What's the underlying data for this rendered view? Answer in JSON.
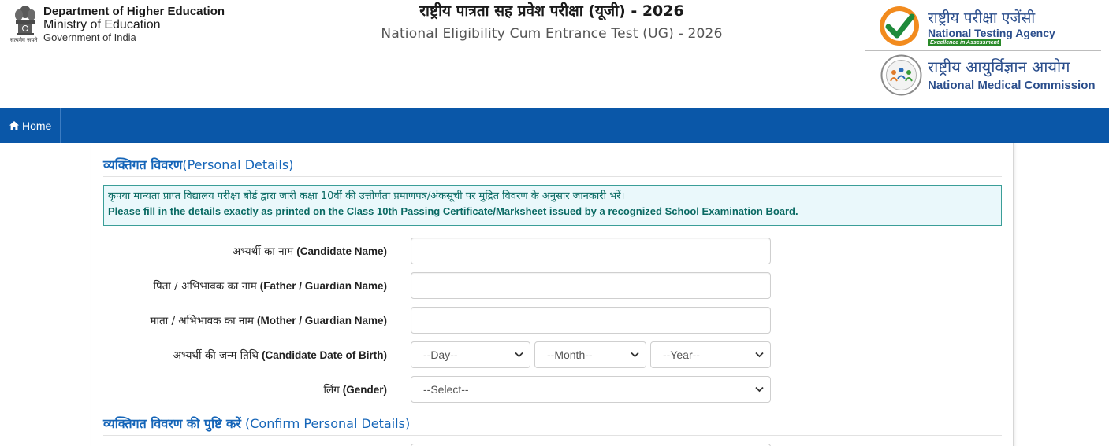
{
  "header": {
    "emblem_caption": "सत्यमेव जयते",
    "dept_line1": "Department of Higher Education",
    "dept_line2": "Ministry of Education",
    "dept_line3": "Government of India",
    "title_hi": "राष्ट्रीय पात्रता सह प्रवेश परीक्षा (यूजी) - 2026",
    "title_en": "National Eligibility Cum Entrance Test (UG) - 2026",
    "nta_hi": "राष्ट्रीय परीक्षा एजेंसी",
    "nta_en": "National Testing Agency",
    "nta_tagline": "Excellence in Assessment",
    "nmc_hi": "राष्ट्रीय आयुर्विज्ञान आयोग",
    "nmc_en": "National Medical Commission"
  },
  "nav": {
    "home_label": "Home"
  },
  "personal": {
    "title_hi": "व्यक्तिगत विवरण",
    "title_en": "(Personal Details)",
    "notice_hi": "कृपया मान्यता प्राप्त विद्यालय परीक्षा बोर्ड द्वारा जारी कक्षा 10वीं की उत्तीर्णता प्रमाणपत्र/अंकसूची पर मुद्रित विवरण के अनुसार जानकारी भरें।",
    "notice_en": "Please fill in the details exactly as printed on the Class 10th Passing Certificate/Marksheet issued by a recognized School Examination Board.",
    "fields": [
      {
        "label_hi": "अभ्यर्थी का नाम",
        "label_en": "(Candidate Name)",
        "value": ""
      },
      {
        "label_hi": "पिता / अभिभावक का नाम",
        "label_en": "(Father / Guardian Name)",
        "value": ""
      },
      {
        "label_hi": "माता / अभिभावक का नाम",
        "label_en": "(Mother / Guardian Name)",
        "value": ""
      }
    ],
    "dob": {
      "label_hi": "अभ्यर्थी की जन्म तिथि",
      "label_en": "(Candidate Date of Birth)",
      "day": "--Day--",
      "month": "--Month--",
      "year": "--Year--"
    },
    "gender": {
      "label_hi": "लिंग",
      "label_en": "(Gender)",
      "selected": "--Select--"
    }
  },
  "confirm": {
    "title_hi": "व्यक्तिगत विवरण की पुष्टि करें",
    "title_en": "(Confirm Personal Details)"
  },
  "colors": {
    "navbar": "#0a57a8",
    "section_title": "#1565b8",
    "notice_bg": "#eaf8fb",
    "notice_text": "#0a6a63"
  }
}
